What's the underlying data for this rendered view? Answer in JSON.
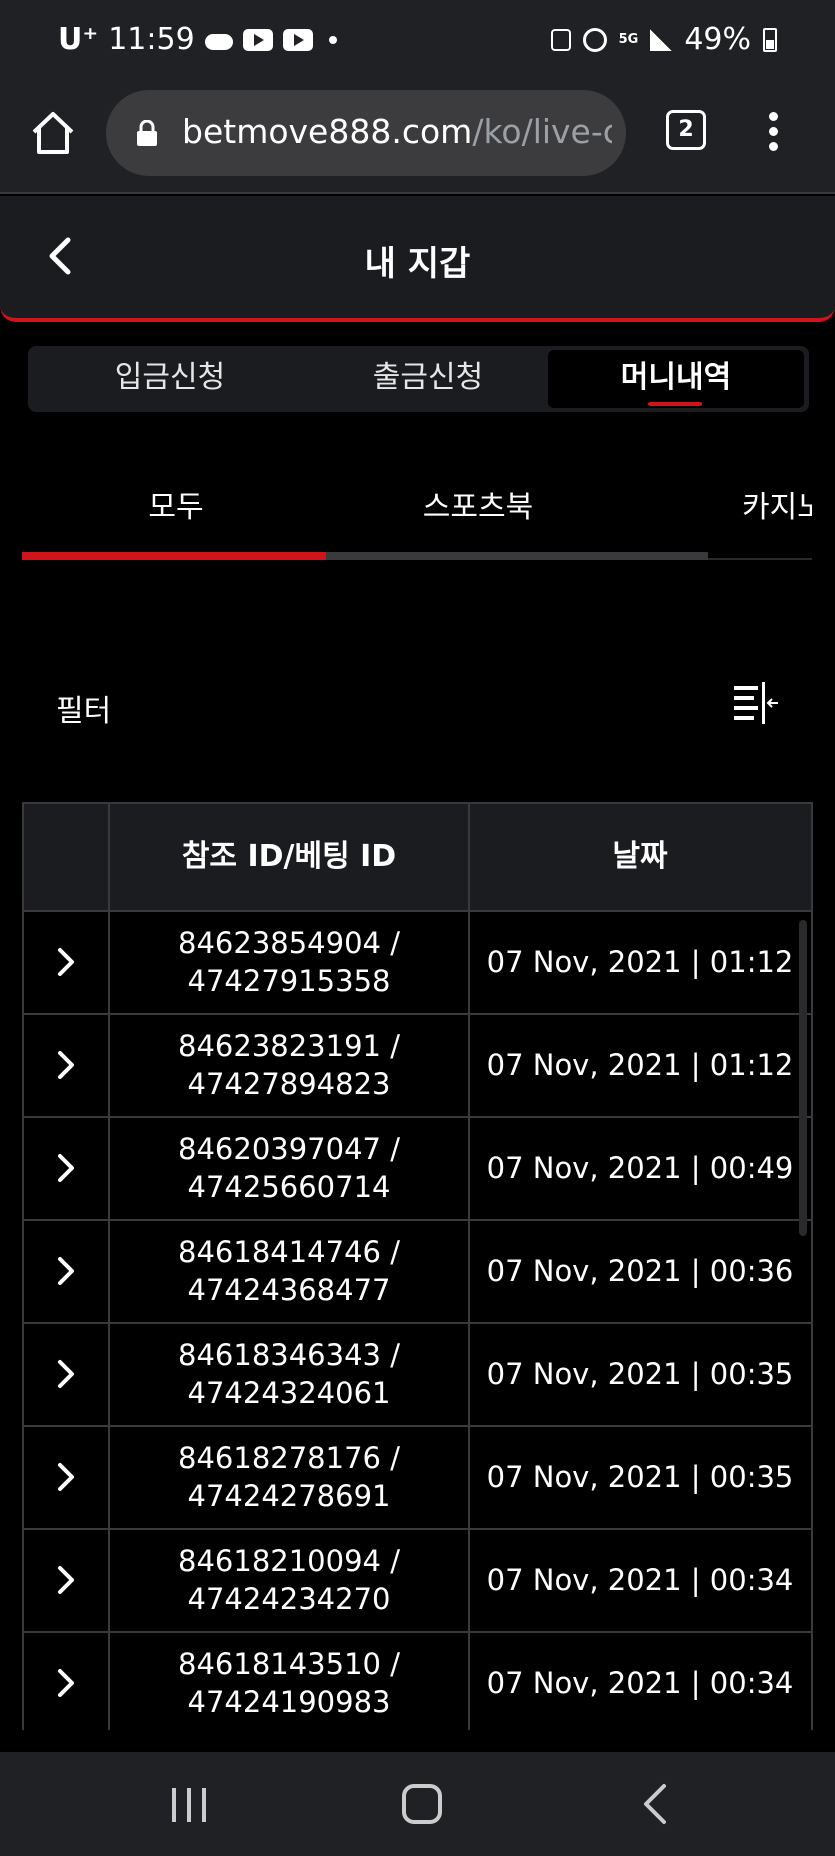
{
  "status_bar": {
    "carrier": "U⁺",
    "time": "11:59",
    "network": "5G",
    "battery": "49%"
  },
  "browser": {
    "url_host": "betmove888.com",
    "url_path": "/ko/live-ca",
    "tab_count": "2"
  },
  "header": {
    "title": "내 지갑"
  },
  "main_tabs": [
    {
      "label": "입금신청",
      "active": false
    },
    {
      "label": "출금신청",
      "active": false
    },
    {
      "label": "머니내역",
      "active": true
    }
  ],
  "sub_tabs": [
    {
      "label": "모두",
      "active": true
    },
    {
      "label": "스포츠북",
      "active": false
    },
    {
      "label": "카지노",
      "active": false
    }
  ],
  "filter": {
    "label": "필터"
  },
  "table": {
    "headers": [
      "",
      "참조 ID/베팅 ID",
      "날짜"
    ],
    "rows": [
      {
        "ref_id": "84623854904 /",
        "bet_id": "47427915358",
        "date": "07 Nov, 2021 | 01:12"
      },
      {
        "ref_id": "84623823191 /",
        "bet_id": "47427894823",
        "date": "07 Nov, 2021 | 01:12"
      },
      {
        "ref_id": "84620397047 /",
        "bet_id": "47425660714",
        "date": "07 Nov, 2021 | 00:49"
      },
      {
        "ref_id": "84618414746 /",
        "bet_id": "47424368477",
        "date": "07 Nov, 2021 | 00:36"
      },
      {
        "ref_id": "84618346343 /",
        "bet_id": "47424324061",
        "date": "07 Nov, 2021 | 00:35"
      },
      {
        "ref_id": "84618278176 /",
        "bet_id": "47424278691",
        "date": "07 Nov, 2021 | 00:35"
      },
      {
        "ref_id": "84618210094 /",
        "bet_id": "47424234270",
        "date": "07 Nov, 2021 | 00:34"
      },
      {
        "ref_id": "84618143510 /",
        "bet_id": "47424190983",
        "date": "07 Nov, 2021 | 00:34"
      }
    ]
  },
  "colors": {
    "accent": "#d0141b",
    "background": "#000000",
    "panel": "#1b1c20",
    "border": "#3a3a3d"
  }
}
